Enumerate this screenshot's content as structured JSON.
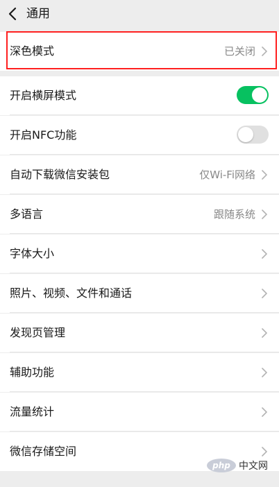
{
  "header": {
    "title": "通用"
  },
  "rows": [
    {
      "label": "深色模式",
      "value": "已关闭"
    },
    {
      "label": "开启横屏模式",
      "toggle": "on"
    },
    {
      "label": "开启NFC功能",
      "toggle": "off"
    },
    {
      "label": "自动下载微信安装包",
      "value": "仅Wi-Fi网络"
    },
    {
      "label": "多语言",
      "value": "跟随系统"
    },
    {
      "label": "字体大小"
    },
    {
      "label": "照片、视频、文件和通话"
    },
    {
      "label": "发现页管理"
    },
    {
      "label": "辅助功能"
    },
    {
      "label": "流量统计"
    },
    {
      "label": "微信存储空间"
    }
  ],
  "icons": {
    "back": "chevron-left-icon",
    "row_arrow": "chevron-right-icon"
  },
  "colors": {
    "toggle_on": "#07c160",
    "toggle_off": "#e0e0e0",
    "highlight": "#ff1f1f"
  },
  "watermark": {
    "logo": "php",
    "text": "中文网"
  }
}
